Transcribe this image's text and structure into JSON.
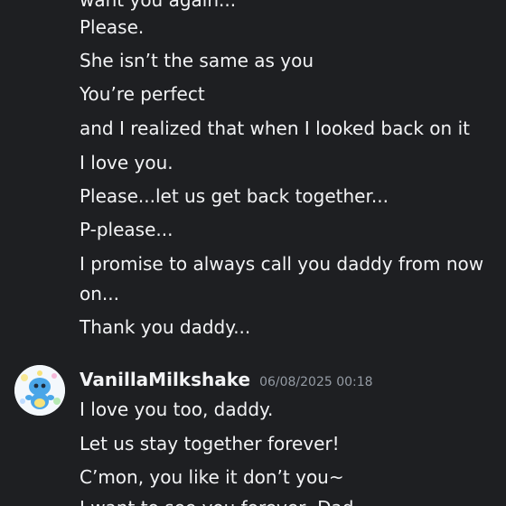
{
  "previous_message": {
    "cut_line": "want you again...",
    "lines": [
      "Please.",
      "She isn’t the same as you",
      "You’re perfect",
      "and I realized that when I looked back on it",
      "I love you.",
      "Please...let us get back together...",
      "P-please...",
      "I promise to always call you daddy from now",
      "on...",
      "Thank you daddy..."
    ]
  },
  "message": {
    "username": "VanillaMilkshake",
    "timestamp": "06/08/2025 00:18",
    "avatar_icon": "chao-avatar-icon",
    "lines": [
      "I love you too, daddy.",
      "Let us stay together forever!",
      "C’mon, you like it don’t you~",
      "I want to see you forever, Dad..."
    ]
  },
  "colors": {
    "background": "#1e1f22",
    "text": "#f2f3f5",
    "timestamp": "#949ba4",
    "avatar_bg": "#f4f8fc",
    "avatar_creature": "#4aa6e8"
  }
}
